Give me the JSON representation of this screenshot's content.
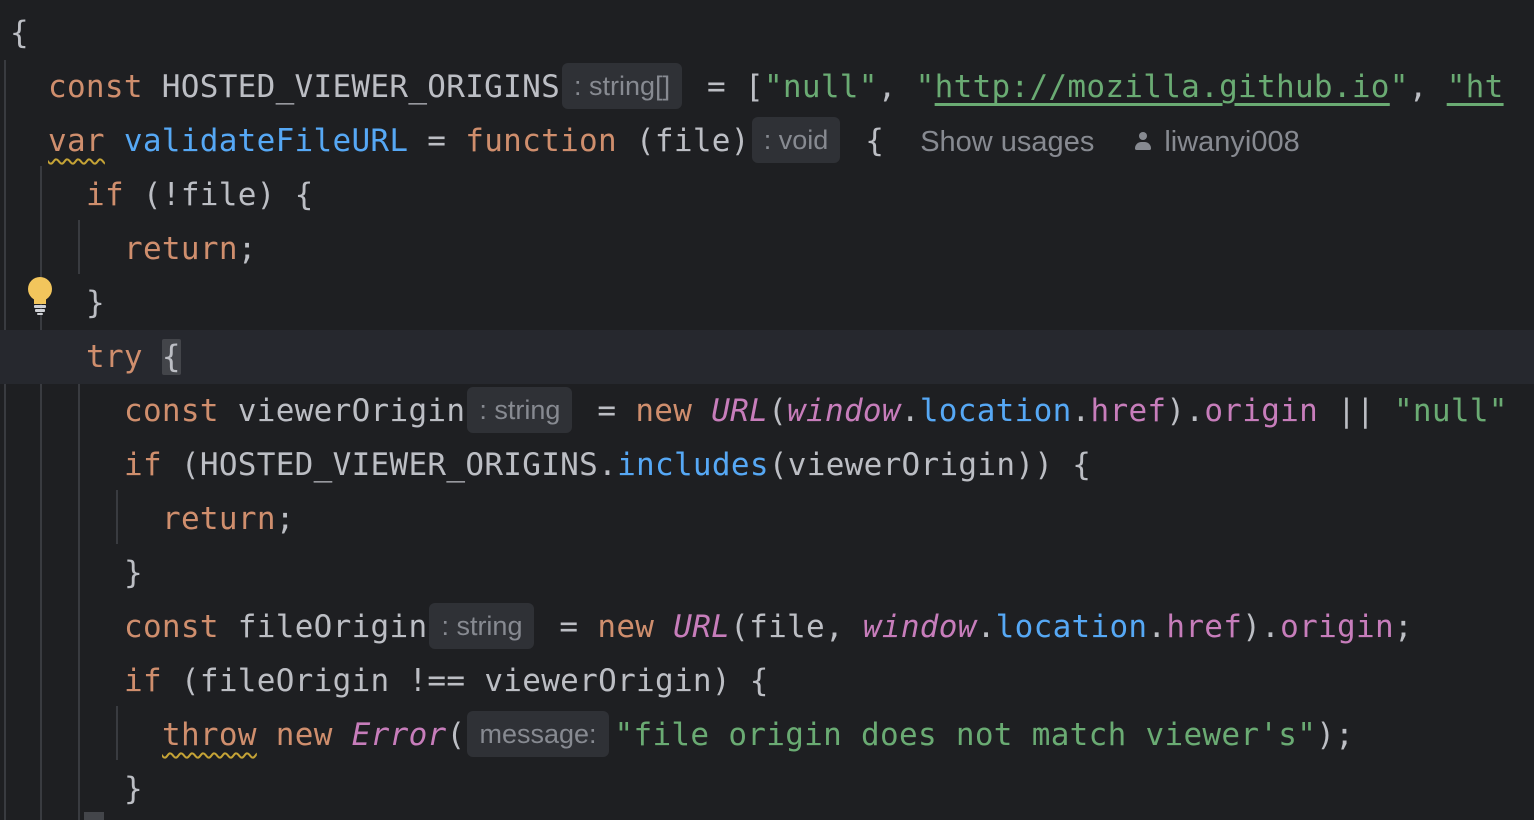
{
  "code": {
    "line1": {
      "brace": "{"
    },
    "line2": {
      "kw": "const",
      "name": "HOSTED_VIEWER_ORIGINS",
      "type_hint": ": string[]",
      "op": " = [",
      "s1": "\"null\"",
      "sep1": ", ",
      "s2_q1": "\"",
      "s2_url": "http://mozilla.github.io",
      "s2_q2": "\"",
      "sep2": ", ",
      "s3": "\"ht"
    },
    "line3": {
      "kw": "var",
      "name": "validateFileURL",
      "op": " = ",
      "fn_kw": "function",
      "params": " (file)",
      "type_hint": ": void",
      "brace": " {",
      "show_usages": "Show usages",
      "author": "liwanyi008"
    },
    "line4": {
      "kw": "if",
      "rest": " (!file) {"
    },
    "line5": {
      "kw": "return",
      "rest": ";"
    },
    "line6": {
      "text": "}"
    },
    "line7": {
      "kw": "try",
      "brace": "{"
    },
    "line8": {
      "kw": "const",
      "name": "viewerOrigin",
      "type_hint": ": string",
      "op": " = ",
      "new_kw": "new",
      "cls": "URL",
      "p1": "(",
      "glob": "window",
      "d1": ".",
      "loc": "location",
      "d2": ".",
      "href": "href",
      "p2": ").",
      "origin": "origin",
      "or": " || ",
      "str": "\"null\""
    },
    "line9": {
      "kw": "if",
      "p1": " (HOSTED_VIEWER_ORIGINS.",
      "method": "includes",
      "p2": "(viewerOrigin)) {"
    },
    "line10": {
      "kw": "return",
      "rest": ";"
    },
    "line11": {
      "text": "}"
    },
    "line12": {
      "kw": "const",
      "name": "fileOrigin",
      "type_hint": ": string",
      "op": " = ",
      "new_kw": "new",
      "cls": "URL",
      "p1": "(file, ",
      "glob": "window",
      "d1": ".",
      "loc": "location",
      "d2": ".",
      "href": "href",
      "p2": ").",
      "origin": "origin",
      "end": ";"
    },
    "line13": {
      "kw": "if",
      "rest": " (fileOrigin !== viewerOrigin) {"
    },
    "line14": {
      "kw": "throw",
      "new_kw": "new",
      "cls": "Error",
      "p1": "(",
      "param_hint": "message:",
      "str": "\"file origin does not match viewer's\"",
      "end": ");"
    },
    "line15": {
      "text": "}"
    }
  },
  "icons": {
    "bulb": "lightbulb-icon",
    "user": "user-icon"
  },
  "colors": {
    "background": "#1e1f22",
    "keyword": "#cf8e6d",
    "function": "#56a8f5",
    "string": "#6aab73",
    "property": "#c77dbb",
    "text": "#bcbec4",
    "hint": "#878a91"
  }
}
